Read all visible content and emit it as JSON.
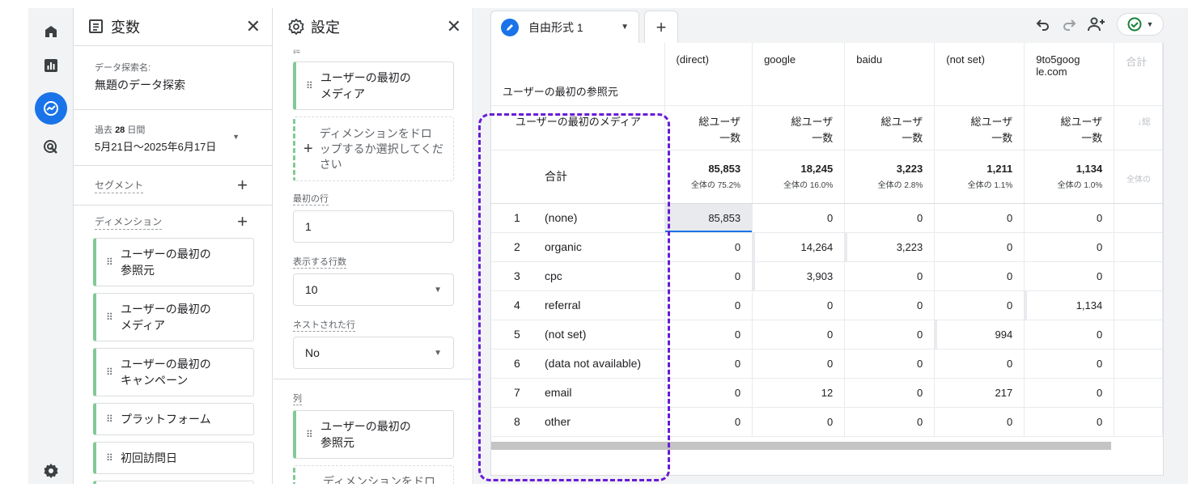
{
  "nav": {
    "items": [
      {
        "icon": "home-icon"
      },
      {
        "icon": "reports-icon"
      },
      {
        "icon": "explore-icon",
        "active": true
      },
      {
        "icon": "advertising-icon"
      }
    ],
    "settings_icon": "gear-icon"
  },
  "variables_panel": {
    "title": "変数",
    "explore_name_label": "データ探索名:",
    "explore_name": "無題のデータ探索",
    "date_range_label_prefix": "過去",
    "date_range_days": "28",
    "date_range_label_suffix": "日間",
    "date_range": "5月21日〜2025年6月17日",
    "segments_label": "セグメント",
    "dimensions_label": "ディメンション",
    "dimensions": [
      "ユーザーの最初の\n参照元",
      "ユーザーの最初の\nメディア",
      "ユーザーの最初の\nキャンペーン",
      "プラットフォーム",
      "初回訪問日"
    ]
  },
  "settings_panel": {
    "title": "設定",
    "top_label": "行",
    "row_chip": "ユーザーの最初の\nメディア",
    "drop_text": "ディメンションをドロ\nップするか選択してくだ\nさい",
    "first_row_label": "最初の行",
    "first_row_value": "1",
    "show_rows_label": "表示する行数",
    "show_rows_value": "10",
    "nested_rows_label": "ネストされた行",
    "nested_rows_value": "No",
    "columns_label": "列",
    "column_chip": "ユーザーの最初の\n参照元",
    "drop_text_2": "ディメンションをドロ"
  },
  "canvas": {
    "tab_label": "自由形式 1",
    "accent": "#1a73e8",
    "highlight_color": "#6a1bd6"
  },
  "table": {
    "column_dimension_header": "ユーザーの最初の参照元",
    "row_dimension_header": "ユーザーの最初のメディア",
    "columns": [
      "(direct)",
      "google",
      "baidu",
      "(not set)",
      "9to5goog\nle.com",
      "合計"
    ],
    "metric_label": "総ユーザ\n一数",
    "last_metric_label": "↓総",
    "totals_label": "合計",
    "totals": [
      {
        "value": "85,853",
        "pct": "全体の 75.2%"
      },
      {
        "value": "18,245",
        "pct": "全体の 16.0%"
      },
      {
        "value": "3,223",
        "pct": "全体の 2.8%"
      },
      {
        "value": "1,211",
        "pct": "全体の 1.1%"
      },
      {
        "value": "1,134",
        "pct": "全体の 1.0%"
      },
      {
        "value": "",
        "pct": "全体の"
      }
    ],
    "rows": [
      {
        "n": "1",
        "label": "(none)",
        "values": [
          "85,853",
          "0",
          "0",
          "0",
          "0"
        ]
      },
      {
        "n": "2",
        "label": "organic",
        "values": [
          "0",
          "14,264",
          "3,223",
          "0",
          "0"
        ]
      },
      {
        "n": "3",
        "label": "cpc",
        "values": [
          "0",
          "3,903",
          "0",
          "0",
          "0"
        ]
      },
      {
        "n": "4",
        "label": "referral",
        "values": [
          "0",
          "0",
          "0",
          "0",
          "1,134"
        ]
      },
      {
        "n": "5",
        "label": "(not set)",
        "values": [
          "0",
          "0",
          "0",
          "994",
          "0"
        ]
      },
      {
        "n": "6",
        "label": "(data not available)",
        "values": [
          "0",
          "0",
          "0",
          "0",
          "0"
        ]
      },
      {
        "n": "7",
        "label": "email",
        "values": [
          "0",
          "12",
          "0",
          "217",
          "0"
        ]
      },
      {
        "n": "8",
        "label": "other",
        "values": [
          "0",
          "0",
          "0",
          "0",
          "0"
        ]
      }
    ]
  }
}
